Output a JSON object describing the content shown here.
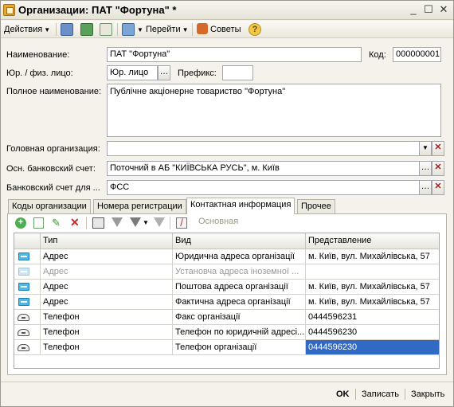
{
  "window": {
    "title": "Организации: ПАТ \"Фортуна\" *",
    "minimize": "_",
    "maximize": "☐",
    "close": "✕"
  },
  "toolbar": {
    "actions_label": "Действия",
    "goto_label": "Перейти",
    "tips_label": "Советы",
    "help_glyph": "?"
  },
  "form": {
    "name_label": "Наименование:",
    "name_value": "ПАТ \"Фортуна\"",
    "code_label": "Код:",
    "code_value": "000000001",
    "entity_label": "Юр. / физ. лицо:",
    "entity_value": "Юр. лицо",
    "prefix_label": "Префикс:",
    "prefix_value": "",
    "fullname_label": "Полное наименование:",
    "fullname_value": "Публічне акціонерне товариство \"Фортуна\"",
    "parent_label": "Головная организация:",
    "parent_value": "",
    "bank_label": "Осн. банковский счет:",
    "bank_value": "Поточний в АБ \"КИЇВСЬКА РУСЬ\", м. Київ",
    "bank_for_label": "Банковский счет для ...",
    "bank_for_value": "ФСС"
  },
  "tabs": [
    {
      "label": "Коды организации"
    },
    {
      "label": "Номера регистрации"
    },
    {
      "label": "Контактная информация"
    },
    {
      "label": "Прочее"
    }
  ],
  "panel": {
    "main_label": "Основная"
  },
  "grid": {
    "columns": [
      "Тип",
      "Вид",
      "Представление"
    ],
    "rows": [
      {
        "type": "Адрес",
        "kind": "Юридична адреса організації",
        "repr": "м. Київ, вул. Михайлівська, 57",
        "icon": "address-icon",
        "disabled": false
      },
      {
        "type": "Адрес",
        "kind": "Установча адреса іноземної ...",
        "repr": "",
        "icon": "address-icon",
        "disabled": true
      },
      {
        "type": "Адрес",
        "kind": "Поштова адреса організації",
        "repr": "м. Київ, вул. Михайлівська, 57",
        "icon": "address-icon",
        "disabled": false
      },
      {
        "type": "Адрес",
        "kind": "Фактична адреса організації",
        "repr": "м. Київ, вул. Михайлівська, 57",
        "icon": "address-icon",
        "disabled": false
      },
      {
        "type": "Телефон",
        "kind": "Факс організації",
        "repr": "0444596231",
        "icon": "phone-icon",
        "disabled": false
      },
      {
        "type": "Телефон",
        "kind": "Телефон по юридичній адресі...",
        "repr": "0444596230",
        "icon": "phone-icon",
        "disabled": false
      },
      {
        "type": "Телефон",
        "kind": "Телефон організації",
        "repr": "0444596230",
        "icon": "phone-icon",
        "disabled": false
      }
    ]
  },
  "footer": {
    "ok_label": "OK",
    "save_label": "Записать",
    "close_label": "Закрыть"
  },
  "colors": {
    "selection": "#316ac5",
    "window_bg": "#f4f2ea"
  }
}
